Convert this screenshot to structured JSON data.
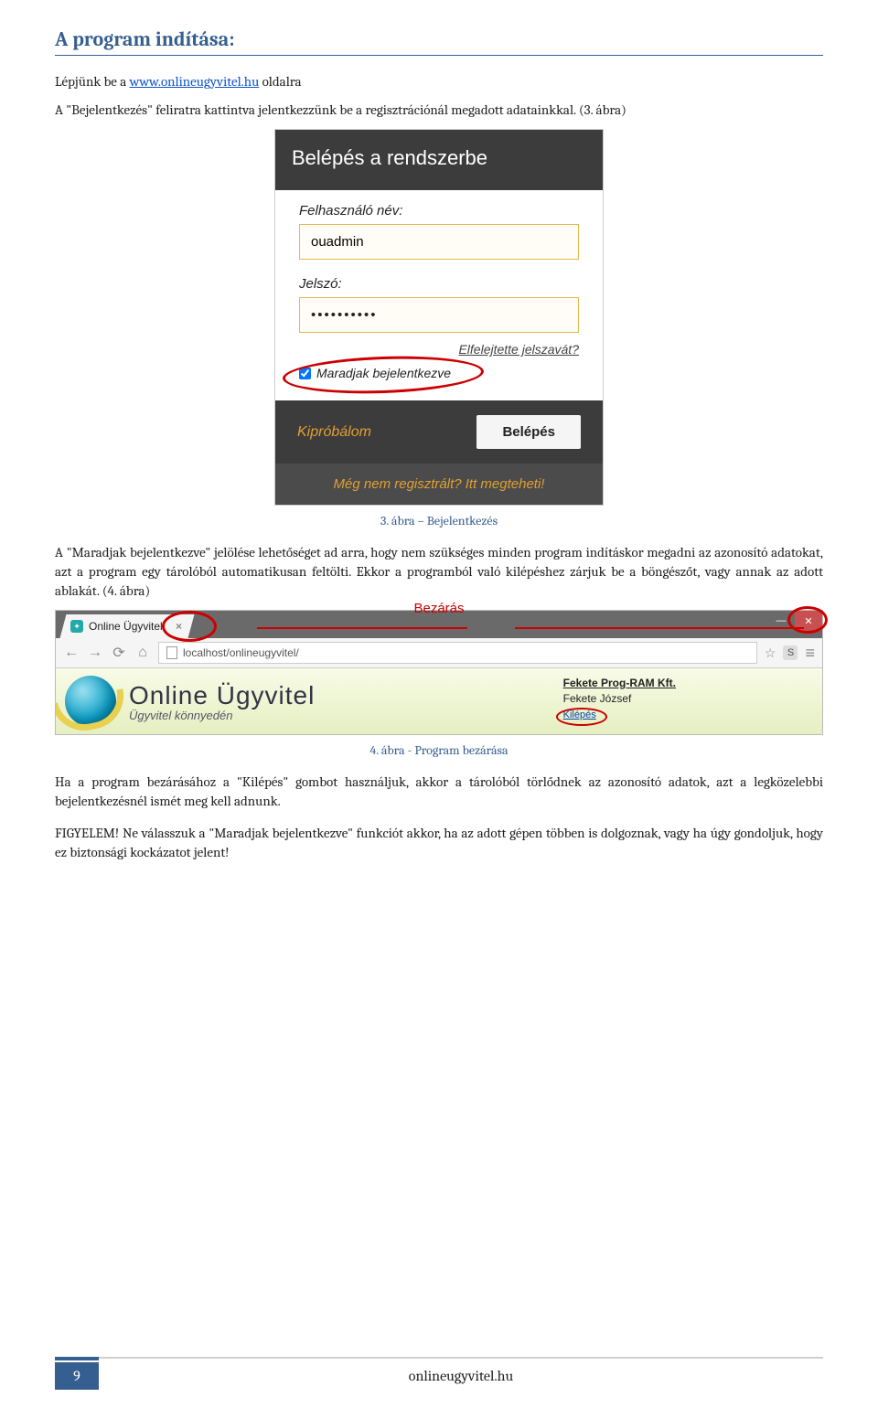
{
  "section_title": "A program indítása:",
  "intro_1a": "Lépjünk be a ",
  "intro_link": "www.onlineugyvitel.hu",
  "intro_1b": "  oldalra",
  "intro_2": "A \"Bejelentkezés\" feliratra kattintva jelentkezzünk be a regisztrációnál megadott adatainkkal. (3. ábra)",
  "login": {
    "header": "Belépés a rendszerbe",
    "user_label": "Felhasználó név:",
    "user_value": "ouadmin",
    "pw_label": "Jelszó:",
    "pw_value": "••••••••••",
    "forgot": "Elfelejtette jelszavát?",
    "remember": "Maradjak bejelentkezve",
    "try_btn": "Kipróbálom",
    "login_btn": "Belépés",
    "register_line": "Még nem regisztrált? Itt megteheti!"
  },
  "caption3": "3. ábra – Bejelentkezés",
  "para_after3": "A \"Maradjak bejelentkezve\" jelölése lehetőséget ad arra, hogy nem szükséges minden program indításkor megadni az azonosító adatokat, azt a program egy tárolóból automatikusan feltölti. Ekkor a programból való kilépéshez zárjuk be a böngészőt, vagy annak az adott ablakát. (4. ábra)",
  "close_annotation": "Bezárás",
  "browser": {
    "tab_title": "Online Ügyvitel",
    "tab_close_x": "×",
    "address": "localhost/onlineugyvitel/",
    "brand": "Online Ügyvitel",
    "brand_sub": "Ügyvitel könnyedén",
    "company": "Fekete Prog-RAM Kft.",
    "user": "Fekete József",
    "logout": "Kilépés"
  },
  "caption4": "4. ábra - Program bezárása",
  "para_after4": "Ha a program bezárásához a \"Kilépés\" gombot használjuk, akkor a tárolóból törlődnek az azonosító adatok, azt a legközelebbi bejelentkezésnél ismét meg kell adnunk.",
  "warning": "FIGYELEM! Ne válasszuk a \"Maradjak bejelentkezve\" funkciót akkor, ha az adott gépen többen is dolgoznak, vagy ha úgy gondoljuk, hogy ez biztonsági kockázatot jelent!",
  "footer": {
    "page": "9",
    "site": "onlineugyvitel.hu"
  }
}
